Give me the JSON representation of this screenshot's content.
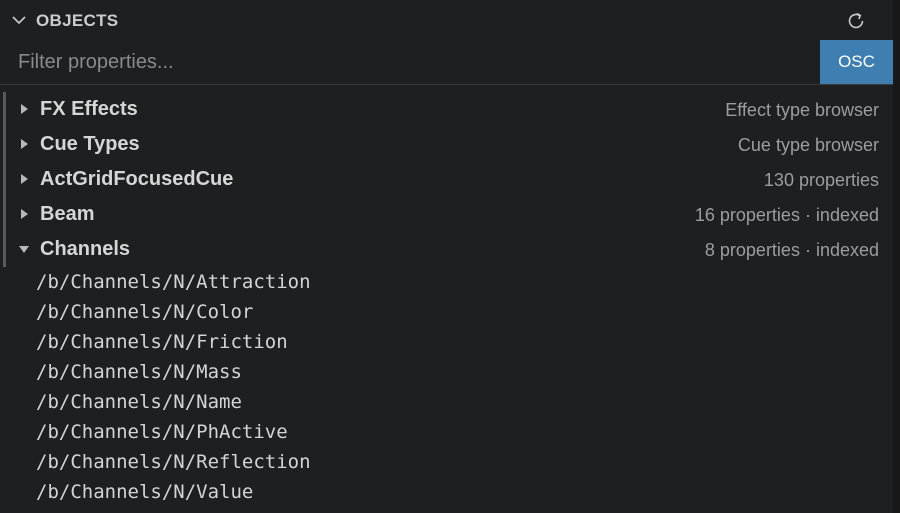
{
  "header": {
    "title": "OBJECTS"
  },
  "filter": {
    "placeholder": "Filter properties...",
    "value": "",
    "button_label": "OSC"
  },
  "tree": {
    "rows": [
      {
        "label": "FX Effects",
        "description": "Effect type browser",
        "expanded": false
      },
      {
        "label": "Cue Types",
        "description": "Cue type browser",
        "expanded": false
      },
      {
        "label": "ActGridFocusedCue",
        "description": "130 properties",
        "expanded": false
      },
      {
        "label": "Beam",
        "description": "16 properties · indexed",
        "expanded": false
      },
      {
        "label": "Channels",
        "description": "8 properties · indexed",
        "expanded": true
      }
    ],
    "children": [
      "/b/Channels/N/Attraction",
      "/b/Channels/N/Color",
      "/b/Channels/N/Friction",
      "/b/Channels/N/Mass",
      "/b/Channels/N/Name",
      "/b/Channels/N/PhActive",
      "/b/Channels/N/Reflection",
      "/b/Channels/N/Value"
    ]
  },
  "icons": {
    "collapse": "chevron-down-icon",
    "refresh": "refresh-icon",
    "collapsed_row": "triangle-right-icon",
    "expanded_row": "triangle-down-icon"
  },
  "colors": {
    "accent": "#3f7eb0",
    "background": "#1e1f20"
  }
}
